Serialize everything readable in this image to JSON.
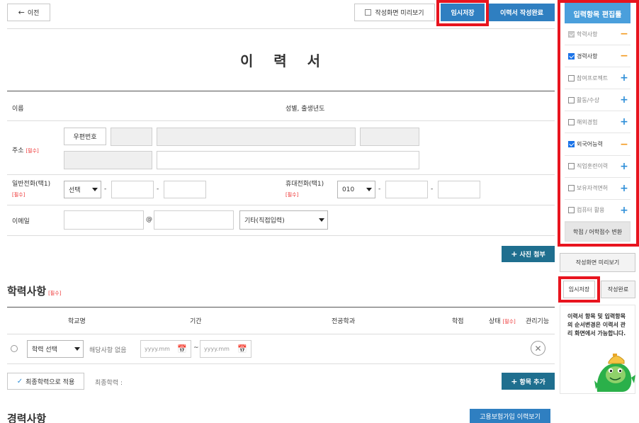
{
  "top": {
    "back_label": "이전",
    "preview_label": "작성화면 미리보기",
    "temp_save_label": "임시저장",
    "complete_label": "이력서 작성완료"
  },
  "title": "이   력   서",
  "form": {
    "name_label": "이름",
    "gender_birth_label": "성별, 출생년도",
    "address_label": "주소",
    "required_mark": "[필수]",
    "zipcode_button": "우편번호",
    "phone_label": "일반전화(택1)",
    "phone_select": "선택",
    "mobile_label": "휴대전화(택1)",
    "mobile_select": "010",
    "dash": "-",
    "email_label": "이메일",
    "at": "@",
    "email_domain_select": "기타(직접입력)",
    "photo_button": "사진 첨부"
  },
  "education": {
    "title": "학력사항",
    "required_mark": "[필수]",
    "columns": {
      "school": "학교명",
      "period": "기간",
      "major": "전공학과",
      "credit": "학점",
      "status": "상태",
      "status_req": "[필수]",
      "manage": "관리기능"
    },
    "row": {
      "level_select": "학력 선택",
      "none_text": "해당사항 없음",
      "date_placeholder": "yyyy.mm",
      "tilde": "~"
    },
    "final_button": "최종학력으로 적용",
    "final_label": "최종학력 :",
    "add_button": "항목 추가"
  },
  "career": {
    "title": "경력사항",
    "insurance_button": "고용보험가입 이력보기"
  },
  "sidebar": {
    "header": "입력항목 편집툴",
    "items": [
      {
        "label": "학력사항",
        "state": "disabled",
        "sign": "−"
      },
      {
        "label": "경력사항",
        "state": "checked",
        "sign": "−"
      },
      {
        "label": "참여프로젝트",
        "state": "unchecked",
        "sign": "+"
      },
      {
        "label": "활동/수상",
        "state": "unchecked",
        "sign": "+"
      },
      {
        "label": "해외경험",
        "state": "unchecked",
        "sign": "+"
      },
      {
        "label": "외국어능력",
        "state": "checked",
        "sign": "−"
      },
      {
        "label": "직업훈련이력",
        "state": "unchecked",
        "sign": "+"
      },
      {
        "label": "보유자격면허",
        "state": "unchecked",
        "sign": "+"
      },
      {
        "label": "컴퓨터 활용",
        "state": "unchecked",
        "sign": "+"
      }
    ],
    "convert_button": "학점 / 어학점수 변환",
    "preview_button": "작성화면 미리보기",
    "temp_save_button": "임시저장",
    "complete_button": "작성완료",
    "notice": "이력서 항목 및 입력항목의 순서변경은 이력서 관리 화면에서 가능합니다."
  },
  "colors": {
    "primary_blue": "#2f7fc1",
    "teal": "#1f6f8f",
    "sidebar_header": "#4a9fdc",
    "highlight_red": "#e8141e",
    "minus_orange": "#f39a1e",
    "plus_blue": "#2f8fd8"
  }
}
